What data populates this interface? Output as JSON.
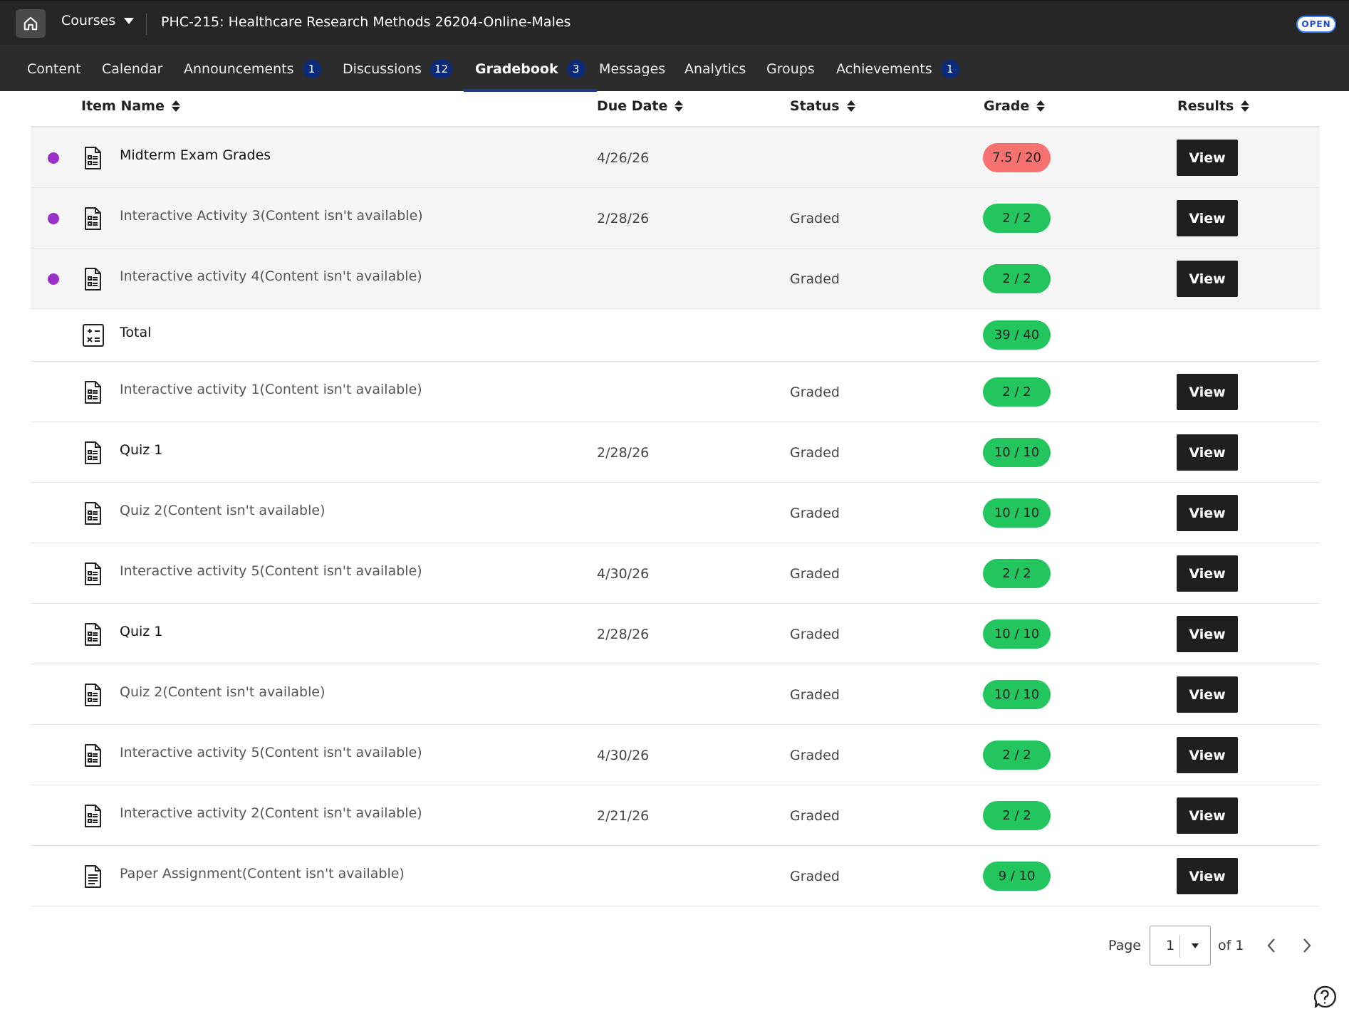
{
  "topbar": {
    "home_icon": "home-icon",
    "courses_label": "Courses",
    "course_title": "PHC-215: Healthcare Research Methods 26204-Online-Males",
    "open_badge": "OPEN"
  },
  "nav": [
    {
      "label": "Content",
      "badge": null,
      "active": false
    },
    {
      "label": "Calendar",
      "badge": null,
      "active": false
    },
    {
      "label": "Announcements",
      "badge": "1",
      "active": false
    },
    {
      "label": "Discussions",
      "badge": "12",
      "active": false
    },
    {
      "label": "Gradebook",
      "badge": "3",
      "active": true
    },
    {
      "label": "Messages",
      "badge": null,
      "active": false
    },
    {
      "label": "Analytics",
      "badge": null,
      "active": false
    },
    {
      "label": "Groups",
      "badge": null,
      "active": false
    },
    {
      "label": "Achievements",
      "badge": "1",
      "active": false
    }
  ],
  "table": {
    "headers": {
      "item_name": "Item Name",
      "due_date": "Due Date",
      "status": "Status",
      "grade": "Grade",
      "results": "Results"
    },
    "rows": [
      {
        "name": "Midterm Exam Grades",
        "due": "4/26/26",
        "status": "",
        "grade": "7.5 / 20",
        "view": "View",
        "unread": true,
        "bold": true,
        "icon": "document-icon",
        "grade_color": "low"
      },
      {
        "name": "Interactive Activity 3(Content isn't available)",
        "due": "2/28/26",
        "status": "Graded",
        "grade": "2 / 2",
        "view": "View",
        "unread": true,
        "bold": false,
        "icon": "document-icon"
      },
      {
        "name": "Interactive activity 4(Content isn't available)",
        "due": "",
        "status": "Graded",
        "grade": "2 / 2",
        "view": "View",
        "unread": true,
        "bold": false,
        "icon": "document-icon"
      },
      {
        "name": "Total",
        "due": "",
        "status": "",
        "grade": "39 / 40",
        "view": "",
        "unread": false,
        "bold": true,
        "icon": "calculator-icon",
        "total": true
      },
      {
        "name": "Interactive activity 1(Content isn't available)",
        "due": "",
        "status": "Graded",
        "grade": "2 / 2",
        "view": "View",
        "unread": false,
        "bold": false,
        "icon": "document-icon"
      },
      {
        "name": "Quiz 1",
        "due": "2/28/26",
        "status": "Graded",
        "grade": "10 / 10",
        "view": "View",
        "unread": false,
        "bold": true,
        "icon": "document-icon"
      },
      {
        "name": "Quiz 2(Content isn't available)",
        "due": "",
        "status": "Graded",
        "grade": "10 / 10",
        "view": "View",
        "unread": false,
        "bold": false,
        "icon": "document-icon"
      },
      {
        "name": "Interactive activity 5(Content isn't available)",
        "due": "4/30/26",
        "status": "Graded",
        "grade": "2 / 2",
        "view": "View",
        "unread": false,
        "bold": false,
        "icon": "document-icon"
      },
      {
        "name": "Quiz 1",
        "due": "2/28/26",
        "status": "Graded",
        "grade": "10 / 10",
        "view": "View",
        "unread": false,
        "bold": true,
        "icon": "document-icon"
      },
      {
        "name": "Quiz 2(Content isn't available)",
        "due": "",
        "status": "Graded",
        "grade": "10 / 10",
        "view": "View",
        "unread": false,
        "bold": false,
        "icon": "document-icon"
      },
      {
        "name": "Interactive activity 5(Content isn't available)",
        "due": "4/30/26",
        "status": "Graded",
        "grade": "2 / 2",
        "view": "View",
        "unread": false,
        "bold": false,
        "icon": "document-icon"
      },
      {
        "name": "Interactive activity 2(Content isn't available)",
        "due": "2/21/26",
        "status": "Graded",
        "grade": "2 / 2",
        "view": "View",
        "unread": false,
        "bold": false,
        "icon": "document-icon"
      },
      {
        "name": "Paper Assignment(Content isn't available)",
        "due": "",
        "status": "Graded",
        "grade": "9 / 10",
        "view": "View",
        "unread": false,
        "bold": false,
        "icon": "text-document-icon"
      }
    ]
  },
  "pagination": {
    "page_label": "Page",
    "current_page": "1",
    "of_label": "of 1"
  },
  "colors": {
    "topbar": "#262626",
    "nav_badge": "#0b2a7a",
    "grade_pass": "#22c55e",
    "grade_low": "#f87171",
    "unread_dot": "#9b2fc9"
  }
}
